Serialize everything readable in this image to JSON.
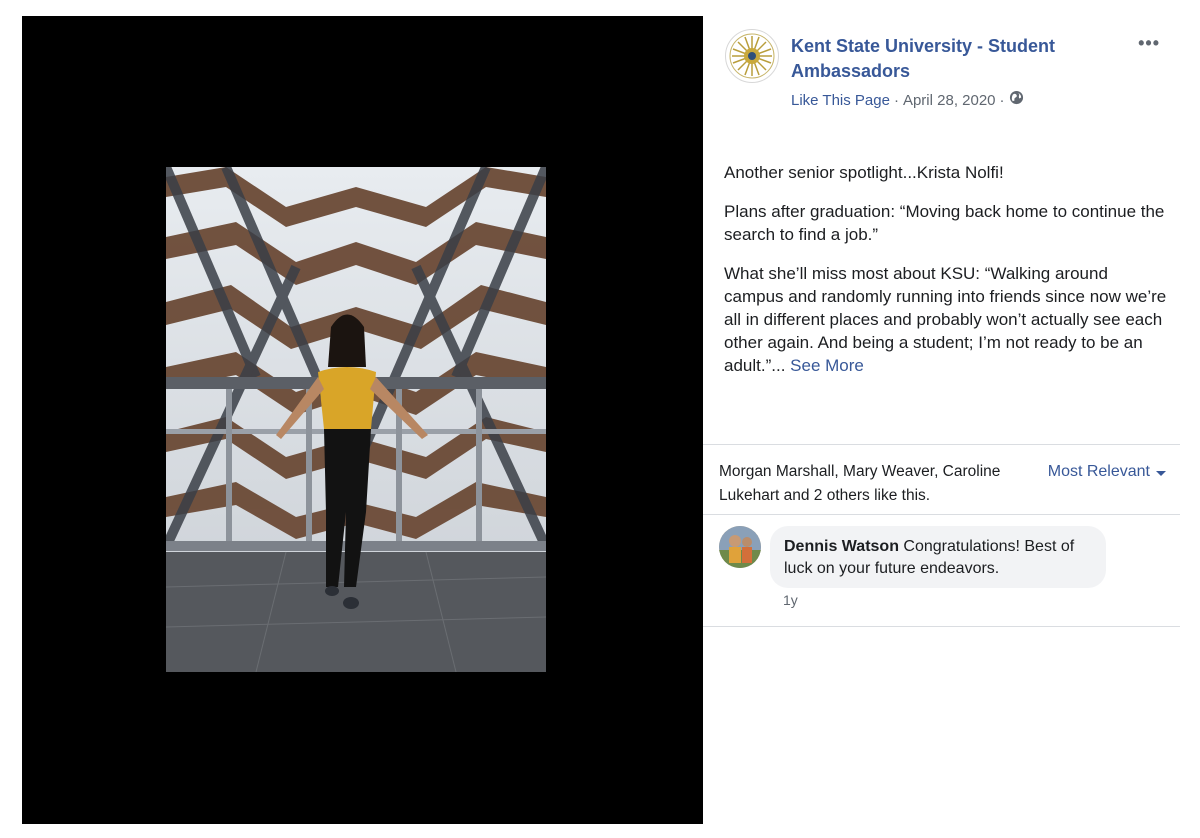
{
  "page": {
    "name": "Kent State University - Student Ambassadors",
    "like_label": "Like This Page",
    "sep1": "·",
    "date": "April 28, 2020",
    "sep2": "·",
    "more": "•••",
    "globe_icon": "globe-icon"
  },
  "post": {
    "p1": "Another senior spotlight...Krista Nolfi!",
    "p2": "Plans after graduation: “Moving back home to continue the search to find a job.”",
    "p3": "What she’ll miss most about KSU: “Walking around campus and randomly running into friends since now we’re all in different places and probably won’t actually see each other again. And being a student; I’m not ready to be an adult.”...",
    "see_more": "See More"
  },
  "reactions": {
    "likes_text": "Morgan Marshall, Mary Weaver, Caroline Lukehart and 2 others like this.",
    "sort_label": "Most Relevant"
  },
  "comment": {
    "author": "Dennis Watson",
    "text": "Congratulations! Best of luck on your future endeavors.",
    "time": "1y"
  },
  "colors": {
    "link": "#385898",
    "muted": "#606770",
    "bubble": "#f2f3f5",
    "viewer_bg": "#000000"
  }
}
